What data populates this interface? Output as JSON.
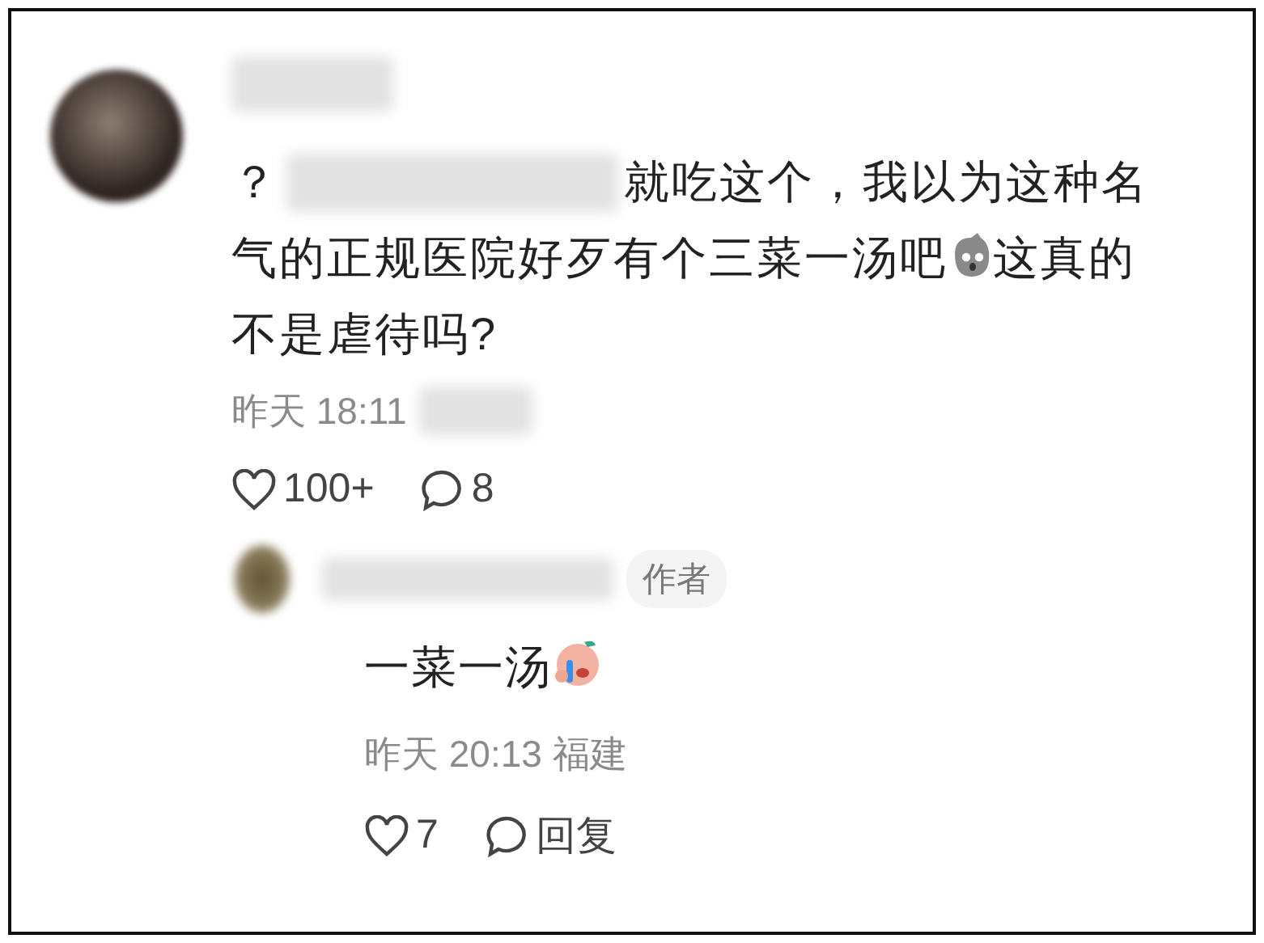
{
  "comment": {
    "lines": [
      [
        {
          "kind": "text",
          "text": "？"
        },
        {
          "kind": "redacted"
        },
        {
          "kind": "text",
          "text": "就吃这个，我以为这种名"
        }
      ],
      [
        {
          "kind": "text",
          "text": "气的正规医院好歹有个三菜一汤吧"
        },
        {
          "kind": "emoji"
        },
        {
          "kind": "text",
          "text": "这真的"
        }
      ],
      [
        {
          "kind": "text",
          "text": "不是虐待吗?"
        }
      ]
    ],
    "time": "昨天 18:11",
    "likes": "100+",
    "replies": "8"
  },
  "reply": {
    "badge": "作者",
    "lines": [
      [
        {
          "kind": "text",
          "text": "一菜一汤"
        },
        {
          "kind": "emoji"
        }
      ]
    ],
    "time": "昨天 20:13 福建",
    "likes": "7",
    "reply_label": "回复"
  }
}
